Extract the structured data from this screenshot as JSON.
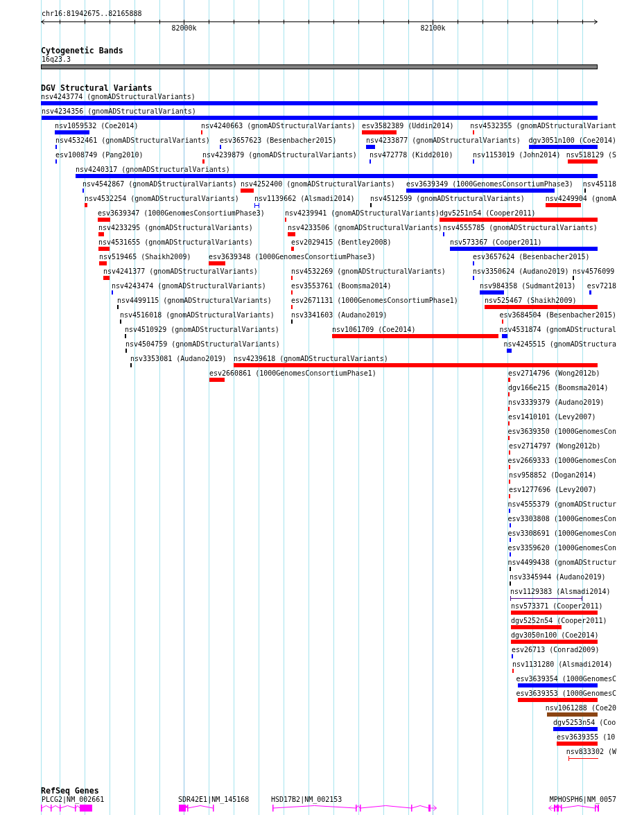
{
  "ruler": {
    "region": "chr16:81942675..82165888",
    "ticks": [
      "82000k",
      "82100k"
    ]
  },
  "cytobands": {
    "title": "Cytogenetic Bands",
    "band": "16q23.3"
  },
  "variants": {
    "title": "DGV Structural Variants",
    "features": [
      {
        "label": "nsv4243774 (gnomADStructuralVariants)",
        "color": "#0000ff",
        "kind": "bar"
      },
      {
        "label": "nsv4234356 (gnomADStructuralVariants)",
        "color": "#0000ff",
        "kind": "bar"
      },
      {
        "label": "nsv1059532 (Coe2014)",
        "color": "#0000ff",
        "kind": "bar"
      },
      {
        "label": "nsv4240663 (gnomADStructuralVariants)",
        "color": "#ff0000",
        "kind": "bar"
      },
      {
        "label": "esv3582389 (Uddin2014)",
        "color": "#ff0000",
        "kind": "bar"
      },
      {
        "label": "nsv4532355 (gnomADStructuralVariant",
        "color": "#ff0000",
        "kind": "bar"
      },
      {
        "label": "nsv4532461 (gnomADStructuralVariants)",
        "color": "#0000ff",
        "kind": "bar"
      },
      {
        "label": "esv3657623 (Besenbacher2015)",
        "color": "#0000ff",
        "kind": "bar"
      },
      {
        "label": "nsv4233877 (gnomADStructuralVariants)",
        "color": "#0000ff",
        "kind": "bar"
      },
      {
        "label": "dgv3051n100 (Coe2014)",
        "color": "#0000ff",
        "kind": "bar"
      },
      {
        "label": "esv1008749 (Pang2010)",
        "color": "#0000ff",
        "kind": "bar"
      },
      {
        "label": "nsv4239879 (gnomADStructuralVariants)",
        "color": "#ff0000",
        "kind": "bar"
      },
      {
        "label": "nsv472778 (Kidd2010)",
        "color": "#0000ff",
        "kind": "bar"
      },
      {
        "label": "nsv1153019 (John2014)",
        "color": "#0000ff",
        "kind": "bar"
      },
      {
        "label": "nsv518129 (S",
        "color": "#ff0000",
        "kind": "bar"
      },
      {
        "label": "nsv4240317 (gnomADStructuralVariants)",
        "color": "#0000ff",
        "kind": "bar"
      },
      {
        "label": "nsv4542867 (gnomADStructuralVariants)",
        "color": "#0000ff",
        "kind": "bar"
      },
      {
        "label": "nsv4252400 (gnomADStructuralVariants)",
        "color": "#ff0000",
        "kind": "bar"
      },
      {
        "label": "esv3639349 (1000GenomesConsortiumPhase3)",
        "color": "#0000ff",
        "kind": "bar"
      },
      {
        "label": "nsv45118",
        "color": "#000000",
        "kind": "bar"
      },
      {
        "label": "nsv4532254 (gnomADStructuralVariants)",
        "color": "#ff0000",
        "kind": "bar"
      },
      {
        "label": "nsv1139662 (Alsmadi2014)",
        "color": "#0000ff",
        "kind": "span"
      },
      {
        "label": "nsv4512599 (gnomADStructuralVariants)",
        "color": "#000000",
        "kind": "bar"
      },
      {
        "label": "nsv4249904 (gnomA",
        "color": "#ff0000",
        "kind": "bar"
      },
      {
        "label": "esv3639347 (1000GenomesConsortiumPhase3)",
        "color": "#ff0000",
        "kind": "bar"
      },
      {
        "label": "nsv4239941 (gnomADStructuralVariants)",
        "color": "#ff0000",
        "kind": "bar"
      },
      {
        "label": "dgv5251n54 (Cooper2011)",
        "color": "#ff0000",
        "kind": "bar"
      },
      {
        "label": "nsv4233295 (gnomADStructuralVariants)",
        "color": "#ff0000",
        "kind": "bar"
      },
      {
        "label": "nsv4233506 (gnomADStructuralVariants)",
        "color": "#ff0000",
        "kind": "bar"
      },
      {
        "label": "nsv4555785 (gnomADStructuralVariants)",
        "color": "#0000ff",
        "kind": "bar"
      },
      {
        "label": "nsv4531655 (gnomADStructuralVariants)",
        "color": "#ff0000",
        "kind": "bar"
      },
      {
        "label": "esv2029415 (Bentley2008)",
        "color": "#ff0000",
        "kind": "bar"
      },
      {
        "label": "nsv573367 (Cooper2011)",
        "color": "#0000ff",
        "kind": "bar"
      },
      {
        "label": "nsv519465 (Shaikh2009)",
        "color": "#ff0000",
        "kind": "bar"
      },
      {
        "label": "esv3639348 (1000GenomesConsortiumPhase3)",
        "color": "#ff0000",
        "kind": "bar"
      },
      {
        "label": "esv3657624 (Besenbacher2015)",
        "color": "#0000ff",
        "kind": "bar"
      },
      {
        "label": "nsv4241377 (gnomADStructuralVariants)",
        "color": "#ff0000",
        "kind": "bar"
      },
      {
        "label": "nsv4532269 (gnomADStructuralVariants)",
        "color": "#ff0000",
        "kind": "bar"
      },
      {
        "label": "nsv3350624 (Audano2019)",
        "color": "#0000ff",
        "kind": "bar"
      },
      {
        "label": "nsv4576099",
        "color": "#000000",
        "kind": "bar"
      },
      {
        "label": "nsv4243474 (gnomADStructuralVariants)",
        "color": "#0000ff",
        "kind": "bar"
      },
      {
        "label": "esv3553761 (Boomsma2014)",
        "color": "#ff0000",
        "kind": "bar"
      },
      {
        "label": "nsv984358 (Sudmant2013)",
        "color": "#0000ff",
        "kind": "bar"
      },
      {
        "label": "esv7218",
        "color": "#0000ff",
        "kind": "bar"
      },
      {
        "label": "nsv4499115 (gnomADStructuralVariants)",
        "color": "#000000",
        "kind": "bar"
      },
      {
        "label": "esv2671131 (1000GenomesConsortiumPhase1)",
        "color": "#ff0000",
        "kind": "bar"
      },
      {
        "label": "nsv525467 (Shaikh2009)",
        "color": "#ff0000",
        "kind": "bar"
      },
      {
        "label": "nsv4516018 (gnomADStructuralVariants)",
        "color": "#000000",
        "kind": "bar"
      },
      {
        "label": "nsv3341603 (Audano2019)",
        "color": "#000000",
        "kind": "bar"
      },
      {
        "label": "esv3684504 (Besenbacher2015)",
        "color": "#ff0000",
        "kind": "bar"
      },
      {
        "label": "nsv4510929 (gnomADStructuralVariants)",
        "color": "#000000",
        "kind": "bar"
      },
      {
        "label": "nsv1061709 (Coe2014)",
        "color": "#ff0000",
        "kind": "bar"
      },
      {
        "label": "nsv4531874 (gnomADStructural",
        "color": "#0000ff",
        "kind": "bar"
      },
      {
        "label": "nsv4504759 (gnomADStructuralVariants)",
        "color": "#000000",
        "kind": "bar"
      },
      {
        "label": "nsv4245515 (gnomADStructura",
        "color": "#0000ff",
        "kind": "bar"
      },
      {
        "label": "nsv3353081 (Audano2019)",
        "color": "#000000",
        "kind": "bar"
      },
      {
        "label": "nsv4239618 (gnomADStructuralVariants)",
        "color": "#ff0000",
        "kind": "bar"
      },
      {
        "label": "esv2660861 (1000GenomesConsortiumPhase1)",
        "color": "#ff0000",
        "kind": "bar"
      },
      {
        "label": "esv2714796 (Wong2012b)",
        "color": "#ff0000",
        "kind": "bar"
      },
      {
        "label": "dgv166e215 (Boomsma2014)",
        "color": "#ff0000",
        "kind": "bar"
      },
      {
        "label": "nsv3339379 (Audano2019)",
        "color": "#ff0000",
        "kind": "bar"
      },
      {
        "label": "esv1410101 (Levy2007)",
        "color": "#ff0000",
        "kind": "bar"
      },
      {
        "label": "esv3639350 (1000GenomesCon",
        "color": "#ff0000",
        "kind": "bar"
      },
      {
        "label": "esv2714797 (Wong2012b)",
        "color": "#ff0000",
        "kind": "bar"
      },
      {
        "label": "esv2669333 (1000GenomesCon",
        "color": "#ff0000",
        "kind": "bar"
      },
      {
        "label": "nsv958852 (Dogan2014)",
        "color": "#ff0000",
        "kind": "bar"
      },
      {
        "label": "esv1277696 (Levy2007)",
        "color": "#ff0000",
        "kind": "bar"
      },
      {
        "label": "nsv4555379 (gnomADStructur",
        "color": "#0000ff",
        "kind": "bar"
      },
      {
        "label": "esv3303808 (1000GenomesCon",
        "color": "#0000ff",
        "kind": "bar"
      },
      {
        "label": "esv3308691 (1000GenomesCon",
        "color": "#0000ff",
        "kind": "bar"
      },
      {
        "label": "esv3359620 (1000GenomesCon",
        "color": "#0000ff",
        "kind": "bar"
      },
      {
        "label": "nsv4499438 (gnomADStructur",
        "color": "#000000",
        "kind": "bar"
      },
      {
        "label": "nsv3345944 (Audano2019)",
        "color": "#000000",
        "kind": "bar"
      },
      {
        "label": "nsv1129383 (Alsmadi2014)",
        "color": "#4b0082",
        "kind": "span"
      },
      {
        "label": "nsv573371 (Cooper2011)",
        "color": "#ff0000",
        "kind": "bar"
      },
      {
        "label": "dgv5252n54 (Cooper2011)",
        "color": "#ff0000",
        "kind": "bar"
      },
      {
        "label": "dgv3050n100 (Coe2014)",
        "color": "#ff0000",
        "kind": "bar"
      },
      {
        "label": "esv26713 (Conrad2009)",
        "color": "#0000ff",
        "kind": "bar"
      },
      {
        "label": "nsv1131280 (Alsmadi2014)",
        "color": "#ff0000",
        "kind": "bar"
      },
      {
        "label": "esv3639354 (1000GenomesC",
        "color": "#0000ff",
        "kind": "bar"
      },
      {
        "label": "esv3639353 (1000GenomesC",
        "color": "#ff0000",
        "kind": "bar"
      },
      {
        "label": "nsv1061288 (Coe20",
        "color": "#8b4513",
        "kind": "bar"
      },
      {
        "label": "dgv5253n54 (Coo",
        "color": "#0000ff",
        "kind": "bar"
      },
      {
        "label": "esv3639355 (10",
        "color": "#ff0000",
        "kind": "bar"
      },
      {
        "label": "nsv833302 (W",
        "color": "#ff0000",
        "kind": "span"
      }
    ]
  },
  "genes": {
    "title": "RefSeq Genes",
    "features": [
      {
        "label": "PLCG2|NM_002661"
      },
      {
        "label": "SDR42E1|NM_145168"
      },
      {
        "label": "HSD17B2|NM_002153"
      },
      {
        "label": "MPHOSPH6|NM_0057"
      }
    ]
  }
}
